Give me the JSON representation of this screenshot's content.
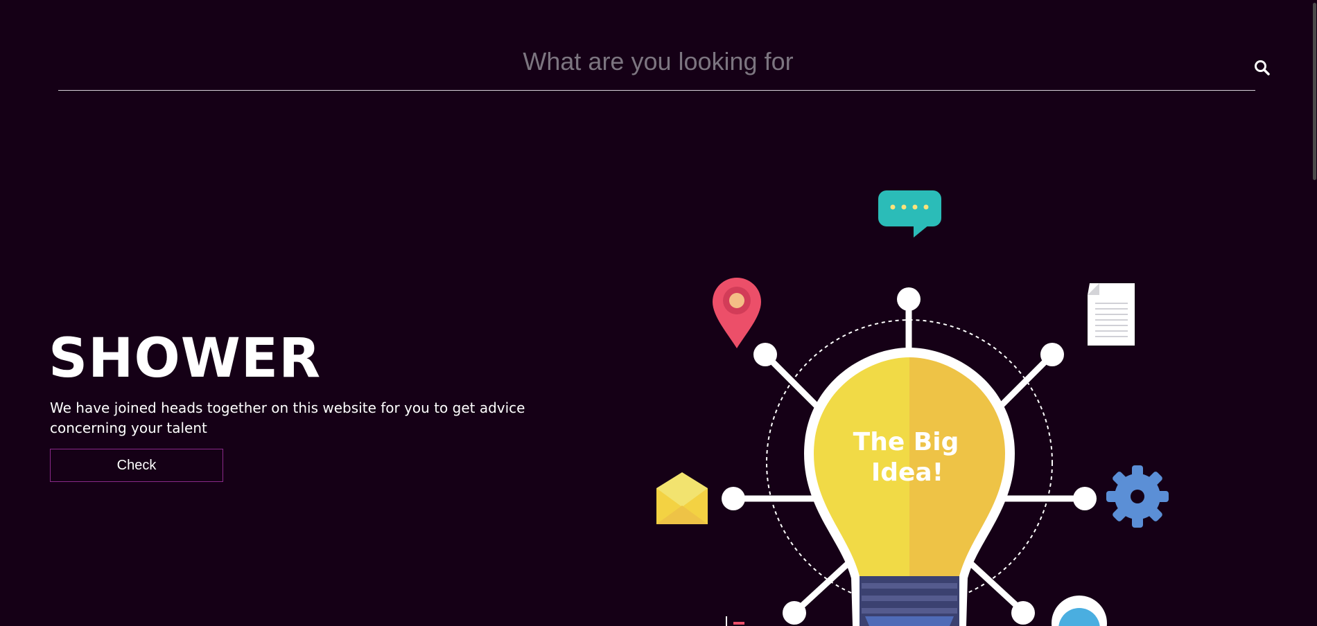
{
  "search": {
    "placeholder": "What are you looking for",
    "icon": "search-icon"
  },
  "hero": {
    "title": "SHOWER",
    "description": "We have joined heads together on this website for you to get advice concerning your talent",
    "button_label": "Check"
  },
  "illustration": {
    "bulb_text_line1": "The Big",
    "bulb_text_line2": "Idea!",
    "icons": [
      "speech-bubble-icon",
      "location-pin-icon",
      "document-icon",
      "envelope-icon",
      "gear-icon",
      "lightbulb-icon"
    ]
  },
  "colors": {
    "background": "#150016",
    "accent_border": "#8a2a8a",
    "bulb_left": "#f1da46",
    "bulb_right": "#eec346",
    "speech_bubble": "#2bbcb8",
    "pin": "#ec4f69",
    "gear": "#5b8fd6"
  }
}
